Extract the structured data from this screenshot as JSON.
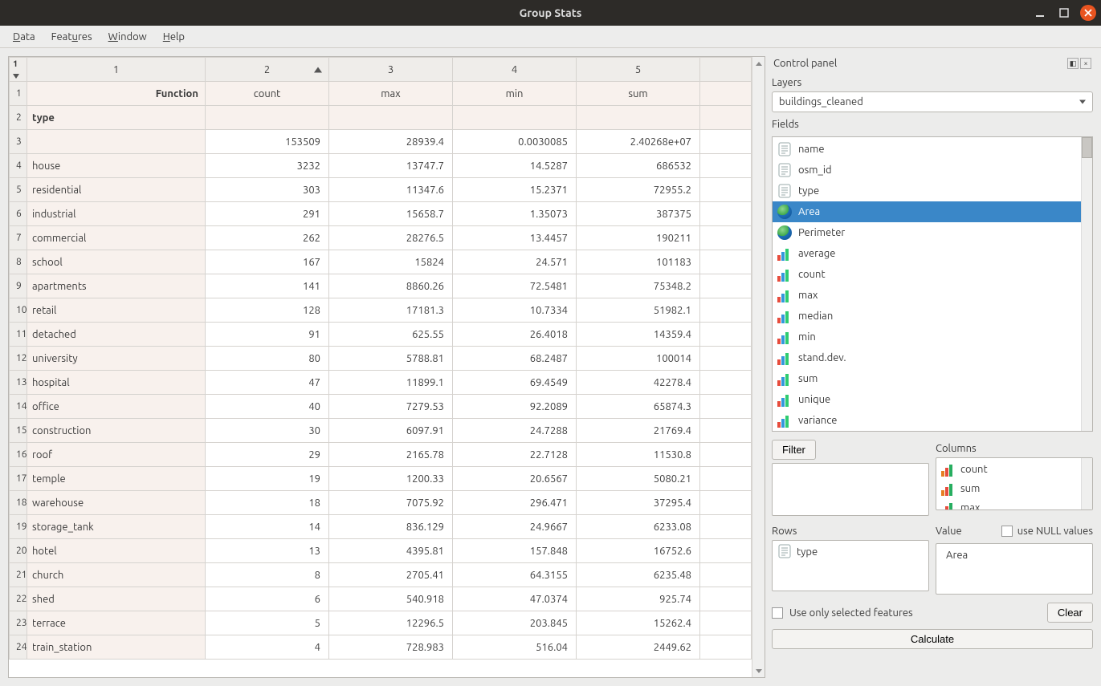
{
  "window": {
    "title": "Group Stats"
  },
  "menu": {
    "data": "Data",
    "features": "Features",
    "window": "Window",
    "help": "Help"
  },
  "table": {
    "corner_sort": "1",
    "col_headers": [
      "1",
      "2",
      "3",
      "4",
      "5"
    ],
    "function_label": "Function",
    "function_cols": [
      "count",
      "max",
      "min",
      "sum"
    ],
    "type_label": "type",
    "rows": [
      {
        "n": "3",
        "type": "",
        "count": "153509",
        "max": "28939.4",
        "min": "0.0030085",
        "sum": "2.40268e+07"
      },
      {
        "n": "4",
        "type": "house",
        "count": "3232",
        "max": "13747.7",
        "min": "14.5287",
        "sum": "686532"
      },
      {
        "n": "5",
        "type": "residential",
        "count": "303",
        "max": "11347.6",
        "min": "15.2371",
        "sum": "72955.2"
      },
      {
        "n": "6",
        "type": "industrial",
        "count": "291",
        "max": "15658.7",
        "min": "1.35073",
        "sum": "387375"
      },
      {
        "n": "7",
        "type": "commercial",
        "count": "262",
        "max": "28276.5",
        "min": "13.4457",
        "sum": "190211"
      },
      {
        "n": "8",
        "type": "school",
        "count": "167",
        "max": "15824",
        "min": "24.571",
        "sum": "101183"
      },
      {
        "n": "9",
        "type": "apartments",
        "count": "141",
        "max": "8860.26",
        "min": "72.5481",
        "sum": "75348.2"
      },
      {
        "n": "10",
        "type": "retail",
        "count": "128",
        "max": "17181.3",
        "min": "10.7334",
        "sum": "51982.1"
      },
      {
        "n": "11",
        "type": "detached",
        "count": "91",
        "max": "625.55",
        "min": "26.4018",
        "sum": "14359.4"
      },
      {
        "n": "12",
        "type": "university",
        "count": "80",
        "max": "5788.81",
        "min": "68.2487",
        "sum": "100014"
      },
      {
        "n": "13",
        "type": "hospital",
        "count": "47",
        "max": "11899.1",
        "min": "69.4549",
        "sum": "42278.4"
      },
      {
        "n": "14",
        "type": "office",
        "count": "40",
        "max": "7279.53",
        "min": "92.2089",
        "sum": "65874.3"
      },
      {
        "n": "15",
        "type": "construction",
        "count": "30",
        "max": "6097.91",
        "min": "24.7288",
        "sum": "21769.4"
      },
      {
        "n": "16",
        "type": "roof",
        "count": "29",
        "max": "2165.78",
        "min": "22.7128",
        "sum": "11530.8"
      },
      {
        "n": "17",
        "type": "temple",
        "count": "19",
        "max": "1200.33",
        "min": "20.6567",
        "sum": "5080.21"
      },
      {
        "n": "18",
        "type": "warehouse",
        "count": "18",
        "max": "7075.92",
        "min": "296.471",
        "sum": "37295.4"
      },
      {
        "n": "19",
        "type": "storage_tank",
        "count": "14",
        "max": "836.129",
        "min": "24.9667",
        "sum": "6233.08"
      },
      {
        "n": "20",
        "type": "hotel",
        "count": "13",
        "max": "4395.81",
        "min": "157.848",
        "sum": "16752.6"
      },
      {
        "n": "21",
        "type": "church",
        "count": "8",
        "max": "2705.41",
        "min": "64.3155",
        "sum": "6235.48"
      },
      {
        "n": "22",
        "type": "shed",
        "count": "6",
        "max": "540.918",
        "min": "47.0374",
        "sum": "925.74"
      },
      {
        "n": "23",
        "type": "terrace",
        "count": "5",
        "max": "12296.5",
        "min": "203.845",
        "sum": "15262.4"
      },
      {
        "n": "24",
        "type": "train_station",
        "count": "4",
        "max": "728.983",
        "min": "516.04",
        "sum": "2449.62"
      }
    ]
  },
  "panel": {
    "title": "Control panel",
    "layers_label": "Layers",
    "layer_selected": "buildings_cleaned",
    "fields_label": "Fields",
    "fields": [
      {
        "label": "name",
        "icon": "text"
      },
      {
        "label": "osm_id",
        "icon": "text"
      },
      {
        "label": "type",
        "icon": "text"
      },
      {
        "label": "Area",
        "icon": "globe",
        "selected": true
      },
      {
        "label": "Perimeter",
        "icon": "globe"
      },
      {
        "label": "average",
        "icon": "stats"
      },
      {
        "label": "count",
        "icon": "stats"
      },
      {
        "label": "max",
        "icon": "stats"
      },
      {
        "label": "median",
        "icon": "stats"
      },
      {
        "label": "min",
        "icon": "stats"
      },
      {
        "label": "stand.dev.",
        "icon": "stats"
      },
      {
        "label": "sum",
        "icon": "stats"
      },
      {
        "label": "unique",
        "icon": "stats"
      },
      {
        "label": "variance",
        "icon": "stats"
      }
    ],
    "filter_button": "Filter",
    "columns_label": "Columns",
    "columns_items": [
      {
        "label": "count",
        "icon": "stats-orange"
      },
      {
        "label": "sum",
        "icon": "stats-orange"
      },
      {
        "label": "max",
        "icon": "stats-orange"
      }
    ],
    "rows_label": "Rows",
    "value_label": "Value",
    "use_null_label": "use NULL values",
    "rows_items": [
      {
        "label": "type",
        "icon": "text"
      }
    ],
    "value_items": [
      {
        "label": "Area",
        "icon": "globe"
      }
    ],
    "use_selected_label": "Use only selected features",
    "clear_button": "Clear",
    "calculate_button": "Calculate"
  }
}
